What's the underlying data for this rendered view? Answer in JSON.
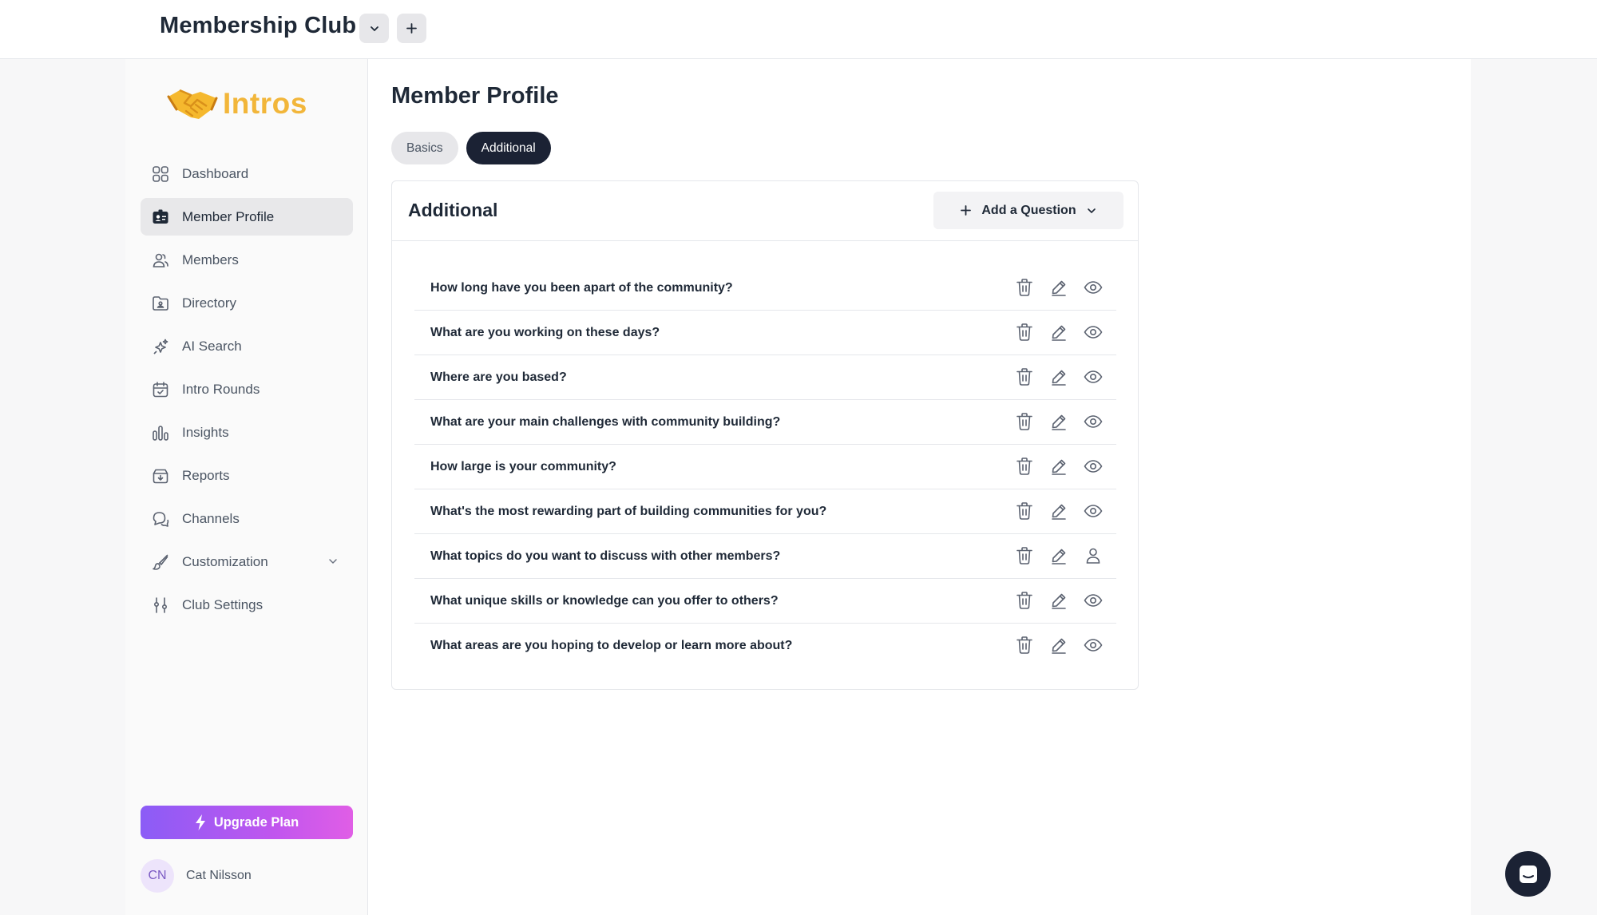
{
  "header": {
    "club_title": "Membership Club",
    "club_switcher_icon": "chevron-down-icon",
    "add_club_icon": "plus-icon"
  },
  "sidebar": {
    "logo_text": "Intros",
    "logo_icon": "handshake-icon",
    "items": [
      {
        "label": "Dashboard",
        "icon": "dashboard-icon"
      },
      {
        "label": "Member Profile",
        "icon": "id-card-icon",
        "active": true
      },
      {
        "label": "Members",
        "icon": "users-icon"
      },
      {
        "label": "Directory",
        "icon": "directory-icon"
      },
      {
        "label": "AI Search",
        "icon": "sparkles-icon"
      },
      {
        "label": "Intro Rounds",
        "icon": "calendar-icon"
      },
      {
        "label": "Insights",
        "icon": "bar-chart-icon"
      },
      {
        "label": "Reports",
        "icon": "inbox-download-icon"
      },
      {
        "label": "Channels",
        "icon": "chat-bubbles-icon"
      },
      {
        "label": "Customization",
        "icon": "brush-icon",
        "has_submenu": true
      },
      {
        "label": "Club Settings",
        "icon": "sliders-icon"
      }
    ],
    "upgrade_label": "Upgrade Plan",
    "user": {
      "initials": "CN",
      "name": "Cat Nilsson"
    }
  },
  "main": {
    "page_title": "Member Profile",
    "tabs": [
      {
        "label": "Basics",
        "active": false
      },
      {
        "label": "Additional",
        "active": true
      }
    ],
    "card": {
      "title": "Additional",
      "add_question_label": "Add a Question",
      "questions": [
        {
          "text": "How long have you been apart of the community?",
          "visibility_icon": "eye-icon"
        },
        {
          "text": "What are you working on these days?",
          "visibility_icon": "eye-icon"
        },
        {
          "text": "Where are you based?",
          "visibility_icon": "eye-icon"
        },
        {
          "text": "What are your main challenges with community building?",
          "visibility_icon": "eye-icon"
        },
        {
          "text": "How large is your community?",
          "visibility_icon": "eye-icon"
        },
        {
          "text": "What's the most rewarding part of building communities for you?",
          "visibility_icon": "eye-icon"
        },
        {
          "text": "What topics do you want to discuss with other members?",
          "visibility_icon": "person-icon"
        },
        {
          "text": "What unique skills or knowledge can you offer to others?",
          "visibility_icon": "eye-icon"
        },
        {
          "text": "What areas are you hoping to develop or learn more about?",
          "visibility_icon": "eye-icon"
        }
      ]
    }
  },
  "chat_widget_icon": "chat-icon",
  "colors": {
    "accent_dark": "#1b2234",
    "logo_yellow": "#f2b63a",
    "upgrade_gradient_start": "#8b5cf6",
    "upgrade_gradient_end": "#e05ee6"
  }
}
